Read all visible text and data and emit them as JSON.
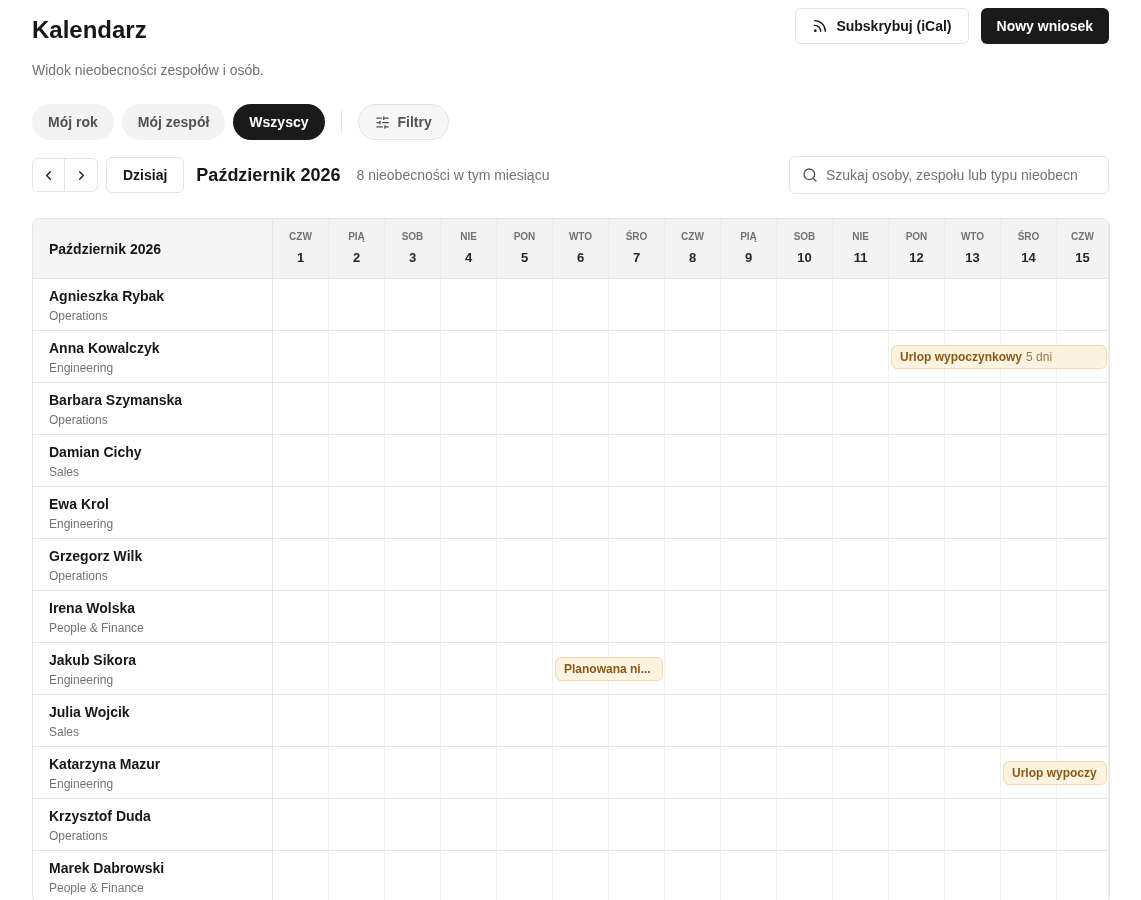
{
  "header": {
    "title": "Kalendarz",
    "subtitle": "Widok nieobecności zespołów i osób.",
    "actions": [
      {
        "kind": "outline",
        "label": "Subskrybuj (iCal)"
      },
      {
        "kind": "primary",
        "label": "Nowy wniosek"
      }
    ]
  },
  "tabs": [
    {
      "label": "Mój rok",
      "selected": false
    },
    {
      "label": "Mój zespół",
      "selected": false
    },
    {
      "label": "Wszyscy",
      "selected": true
    }
  ],
  "filters_button": "Filtry",
  "toolbar": {
    "today": "Dzisiaj",
    "month": "Październik 2026",
    "count": "8 nieobecności w tym miesiącu",
    "search": {
      "placeholder": "Szukaj osoby, zespołu lub typu nieobecn"
    }
  },
  "calendar": {
    "corner": "Październik 2026",
    "days": [
      {
        "dow": "CZW",
        "num": "1"
      },
      {
        "dow": "PIĄ",
        "num": "2"
      },
      {
        "dow": "SOB",
        "num": "3"
      },
      {
        "dow": "NIE",
        "num": "4"
      },
      {
        "dow": "PON",
        "num": "5"
      },
      {
        "dow": "WTO",
        "num": "6"
      },
      {
        "dow": "ŚRO",
        "num": "7"
      },
      {
        "dow": "CZW",
        "num": "8"
      },
      {
        "dow": "PIĄ",
        "num": "9"
      },
      {
        "dow": "SOB",
        "num": "10"
      },
      {
        "dow": "NIE",
        "num": "11"
      },
      {
        "dow": "PON",
        "num": "12"
      },
      {
        "dow": "WTO",
        "num": "13"
      },
      {
        "dow": "ŚRO",
        "num": "14"
      },
      {
        "dow": "CZW",
        "num": "15"
      }
    ],
    "rows": [
      {
        "name": "Agnieszka Rybak",
        "team": "Operations",
        "events": []
      },
      {
        "name": "Anna Kowalczyk",
        "team": "Engineering",
        "events": [
          {
            "label": "Urlop wypoczynkowy",
            "duration": "5 dni"
          }
        ]
      },
      {
        "name": "Barbara Szymanska",
        "team": "Operations",
        "events": []
      },
      {
        "name": "Damian Cichy",
        "team": "Sales",
        "events": []
      },
      {
        "name": "Ewa Krol",
        "team": "Engineering",
        "events": []
      },
      {
        "name": "Grzegorz Wilk",
        "team": "Operations",
        "events": []
      },
      {
        "name": "Irena Wolska",
        "team": "People & Finance",
        "events": []
      },
      {
        "name": "Jakub Sikora",
        "team": "Engineering",
        "events": [
          {
            "label": "Planowana ni..."
          }
        ]
      },
      {
        "name": "Julia Wojcik",
        "team": "Sales",
        "events": []
      },
      {
        "name": "Katarzyna Mazur",
        "team": "Engineering",
        "events": [
          {
            "label": "Urlop wypoczy"
          }
        ]
      },
      {
        "name": "Krzysztof Duda",
        "team": "Operations",
        "events": []
      },
      {
        "name": "Marek Dabrowski",
        "team": "People & Finance",
        "events": []
      }
    ]
  }
}
